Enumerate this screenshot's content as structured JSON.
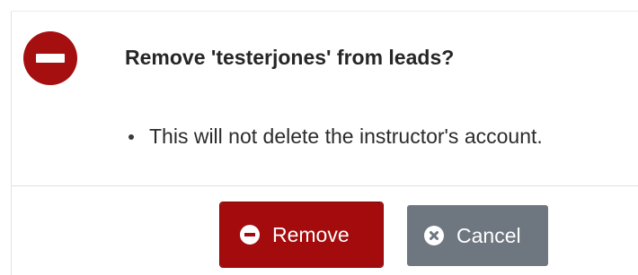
{
  "dialog": {
    "title": "Remove 'testerjones' from leads?",
    "messages": [
      "This will not delete the instructor's account."
    ],
    "buttons": {
      "remove_label": "Remove",
      "cancel_label": "Cancel"
    },
    "icons": {
      "header": "minus-circle-icon",
      "remove": "minus-circle-icon",
      "cancel": "times-circle-icon"
    },
    "colors": {
      "danger": "#a30b0d",
      "secondary": "#6e7680",
      "text": "#262626"
    }
  }
}
